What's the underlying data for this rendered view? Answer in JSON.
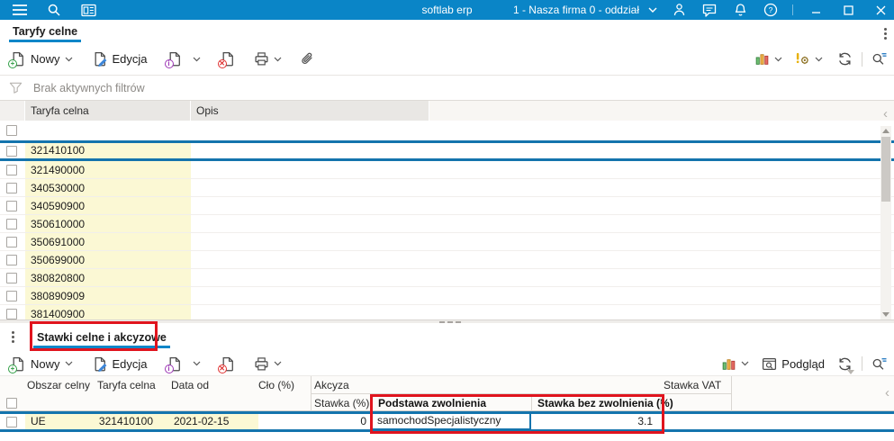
{
  "titlebar": {
    "app_title": "softlab erp",
    "company_selector": "1 - Nasza firma 0 - oddział"
  },
  "tabs": {
    "main_tab": "Taryfy celne",
    "detail_tab": "Stawki celne i akcyzowe"
  },
  "toolbar": {
    "new_label": "Nowy",
    "edit_label": "Edycja",
    "preview_label": "Podgląd"
  },
  "filter_bar": {
    "status_text": "Brak aktywnych filtrów"
  },
  "top_grid": {
    "columns": {
      "taryfa": "Taryfa celna",
      "opis": "Opis"
    },
    "rows": [
      "321410100",
      "321490000",
      "340530000",
      "340590900",
      "350610000",
      "350691000",
      "350699000",
      "380820800",
      "380890909",
      "381400900"
    ],
    "selected_row": "321410100"
  },
  "bottom_grid": {
    "header": {
      "obszar": "Obszar celny",
      "taryfa": "Taryfa celna",
      "data_od": "Data od",
      "clo": "Cło (%)",
      "akcyza_group": "Akcyza",
      "stawka": "Stawka (%)",
      "podstawa": "Podstawa zwolnienia",
      "stawka_bez": "Stawka bez zwolnienia (%)",
      "vat": "Stawka VAT"
    },
    "row": {
      "obszar": "UE",
      "taryfa": "321410100",
      "data_od": "2021-02-15",
      "clo": "",
      "stawka": "0",
      "podstawa": "samochodSpecjalistyczny",
      "stawka_bez": "3.1",
      "vat": ""
    }
  },
  "icons": {
    "collapse_left": "‹"
  },
  "colors": {
    "titlebar_blue": "#0a85c7",
    "accent_blue": "#0f86c8",
    "selection_blue": "#1474ad",
    "row_highlight_yellow": "#fbf8d4",
    "annotation_red": "#e0141e"
  }
}
